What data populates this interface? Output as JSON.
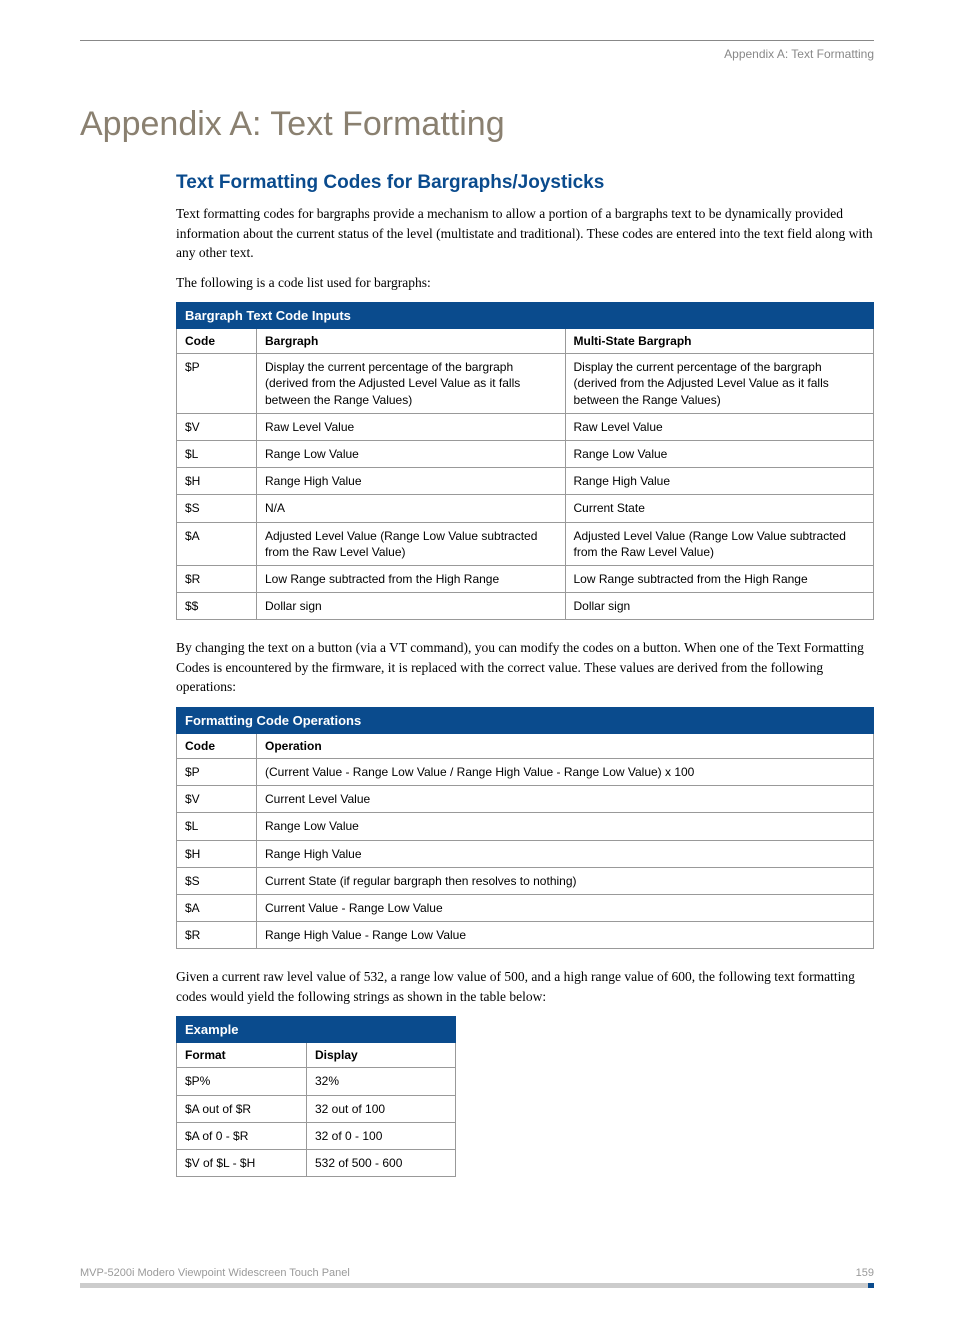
{
  "running_head": "Appendix A: Text Formatting",
  "h1": "Appendix A: Text Formatting",
  "h2": "Text Formatting Codes for Bargraphs/Joysticks",
  "p1": "Text formatting codes for bargraphs provide a mechanism to allow a portion of a bargraphs text to be dynamically provided information about the current status of the level (multistate and traditional). These codes are entered into the text field along with any other text.",
  "p2": "The following is a code list used for bargraphs:",
  "table1": {
    "banner": "Bargraph Text Code Inputs",
    "head": {
      "c0": "Code",
      "c1": "Bargraph",
      "c2": "Multi-State Bargraph"
    },
    "rows": [
      {
        "c0": "$P",
        "c1": "Display the current percentage of the bargraph (derived from the Adjusted Level Value as it falls between the Range Values)",
        "c2": "Display the current percentage of the bargraph (derived from the Adjusted Level Value as it falls between the Range Values)"
      },
      {
        "c0": "$V",
        "c1": "Raw Level Value",
        "c2": "Raw Level Value"
      },
      {
        "c0": "$L",
        "c1": "Range Low Value",
        "c2": "Range Low Value"
      },
      {
        "c0": "$H",
        "c1": "Range High Value",
        "c2": "Range High Value"
      },
      {
        "c0": "$S",
        "c1": "N/A",
        "c2": "Current State"
      },
      {
        "c0": "$A",
        "c1": "Adjusted Level Value (Range Low Value subtracted from the Raw Level Value)",
        "c2": "Adjusted Level Value (Range Low Value subtracted from the Raw Level Value)"
      },
      {
        "c0": "$R",
        "c1": "Low Range subtracted from the High Range",
        "c2": "Low Range subtracted from the High Range"
      },
      {
        "c0": "$$",
        "c1": "Dollar sign",
        "c2": "Dollar sign"
      }
    ]
  },
  "p3": "By changing the text on a button (via a VT command), you can modify the codes on a button. When one of the Text Formatting Codes is encountered by the firmware, it is replaced with the correct value. These values are derived from the following operations:",
  "table2": {
    "banner": "Formatting Code Operations",
    "head": {
      "c0": "Code",
      "c1": "Operation"
    },
    "rows": [
      {
        "c0": "$P",
        "c1": "(Current Value - Range Low Value / Range High Value - Range Low Value) x 100"
      },
      {
        "c0": "$V",
        "c1": "Current Level Value"
      },
      {
        "c0": "$L",
        "c1": "Range Low Value"
      },
      {
        "c0": "$H",
        "c1": "Range High Value"
      },
      {
        "c0": "$S",
        "c1": "Current State (if regular bargraph then resolves to nothing)"
      },
      {
        "c0": "$A",
        "c1": "Current Value - Range Low Value"
      },
      {
        "c0": "$R",
        "c1": "Range High Value - Range Low Value"
      }
    ]
  },
  "p4": "Given a current raw level value of 532, a range low value of 500, and a high range value of 600, the following text formatting codes would yield the following strings as shown in the table below:",
  "table3": {
    "banner": "Example",
    "head": {
      "c0": "Format",
      "c1": "Display"
    },
    "rows": [
      {
        "c0": "$P%",
        "c1": "32%"
      },
      {
        "c0": "$A out of $R",
        "c1": "32 out of 100"
      },
      {
        "c0": "$A of 0 - $R",
        "c1": "32 of 0 - 100"
      },
      {
        "c0": "$V of $L - $H",
        "c1": "532 of 500 - 600"
      }
    ]
  },
  "footer": {
    "left": "MVP-5200i Modero Viewpoint Widescreen Touch Panel",
    "right": "159"
  }
}
